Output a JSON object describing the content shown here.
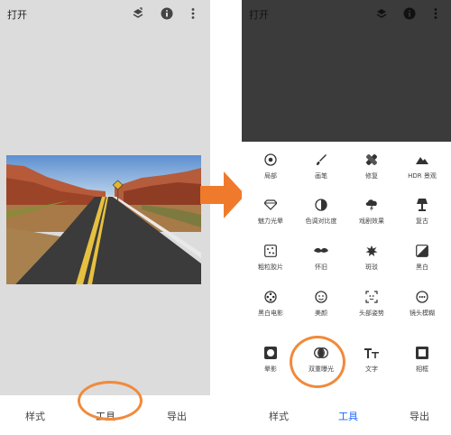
{
  "left": {
    "title": "打开",
    "tabs": [
      "样式",
      "工具",
      "导出"
    ],
    "active_tab": 1
  },
  "right": {
    "title": "打开",
    "tabs": [
      "样式",
      "工具",
      "导出"
    ],
    "active_tab": 1,
    "tools": [
      {
        "label": "局部",
        "icon": "target-icon"
      },
      {
        "label": "画笔",
        "icon": "brush-icon"
      },
      {
        "label": "修复",
        "icon": "bandage-icon"
      },
      {
        "label": "HDR 景观",
        "icon": "mountain-icon"
      },
      {
        "label": "魅力光晕",
        "icon": "diamond-icon"
      },
      {
        "label": "色调对比度",
        "icon": "contrast-icon"
      },
      {
        "label": "戏剧效果",
        "icon": "cloud-lightning-icon"
      },
      {
        "label": "复古",
        "icon": "lamp-icon"
      },
      {
        "label": "粗粒胶片",
        "icon": "film-grain-icon"
      },
      {
        "label": "怀旧",
        "icon": "mustache-icon"
      },
      {
        "label": "斑驳",
        "icon": "splatter-icon"
      },
      {
        "label": "黑白",
        "icon": "bw-icon"
      },
      {
        "label": "黑白电影",
        "icon": "film-reel-icon"
      },
      {
        "label": "美颜",
        "icon": "face-icon"
      },
      {
        "label": "头部姿势",
        "icon": "head-pose-icon"
      },
      {
        "label": "镜头模糊",
        "icon": "lens-blur-icon"
      },
      {
        "label": "晕影",
        "icon": "vignette-icon"
      },
      {
        "label": "双重曝光",
        "icon": "double-exposure-icon"
      },
      {
        "label": "文字",
        "icon": "text-icon"
      },
      {
        "label": "相框",
        "icon": "frame-icon"
      }
    ]
  },
  "colors": {
    "accent": "#1a66ff",
    "highlight": "#f08a3c"
  }
}
